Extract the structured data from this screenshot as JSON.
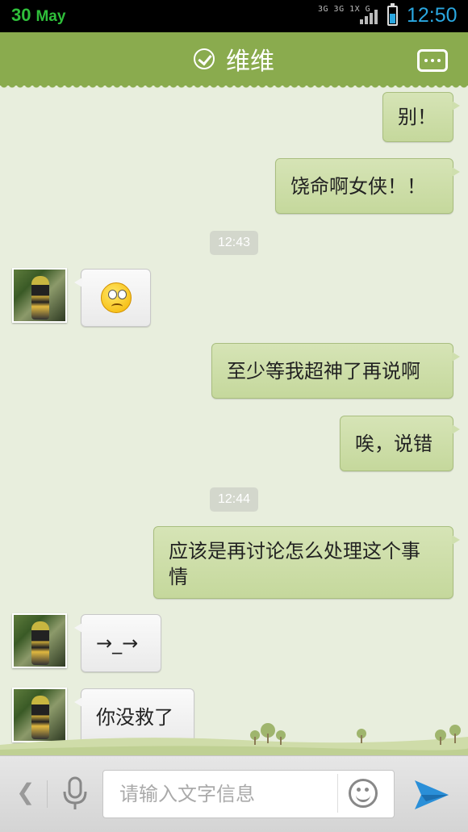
{
  "status_bar": {
    "date_day": "30",
    "date_month": "May",
    "network_labels": "3G 3G 1X G",
    "time": "12:50",
    "battery_level": 0.55
  },
  "header": {
    "contact_name": "维维"
  },
  "messages": [
    {
      "type": "out",
      "text": "别！"
    },
    {
      "type": "out",
      "text": "饶命啊女侠！！"
    },
    {
      "type": "time",
      "text": "12:43"
    },
    {
      "type": "in",
      "emoji": "confused-face-icon"
    },
    {
      "type": "out",
      "text": "至少等我超神了再说啊"
    },
    {
      "type": "out",
      "text": "唉，说错"
    },
    {
      "type": "time",
      "text": "12:44"
    },
    {
      "type": "out",
      "text": "应该是再讨论怎么处理这个事情"
    },
    {
      "type": "in",
      "text": "→_→"
    },
    {
      "type": "in",
      "text": "你没救了"
    }
  ],
  "input_bar": {
    "placeholder": "请输入文字信息"
  },
  "colors": {
    "header_green": "#8aab4e",
    "outgoing_bubble": "#cfdfae",
    "incoming_bubble": "#f5f5f5",
    "chat_background": "#e8eedd",
    "time_accent": "#2aa7e0",
    "date_green": "#2fbf3a"
  }
}
